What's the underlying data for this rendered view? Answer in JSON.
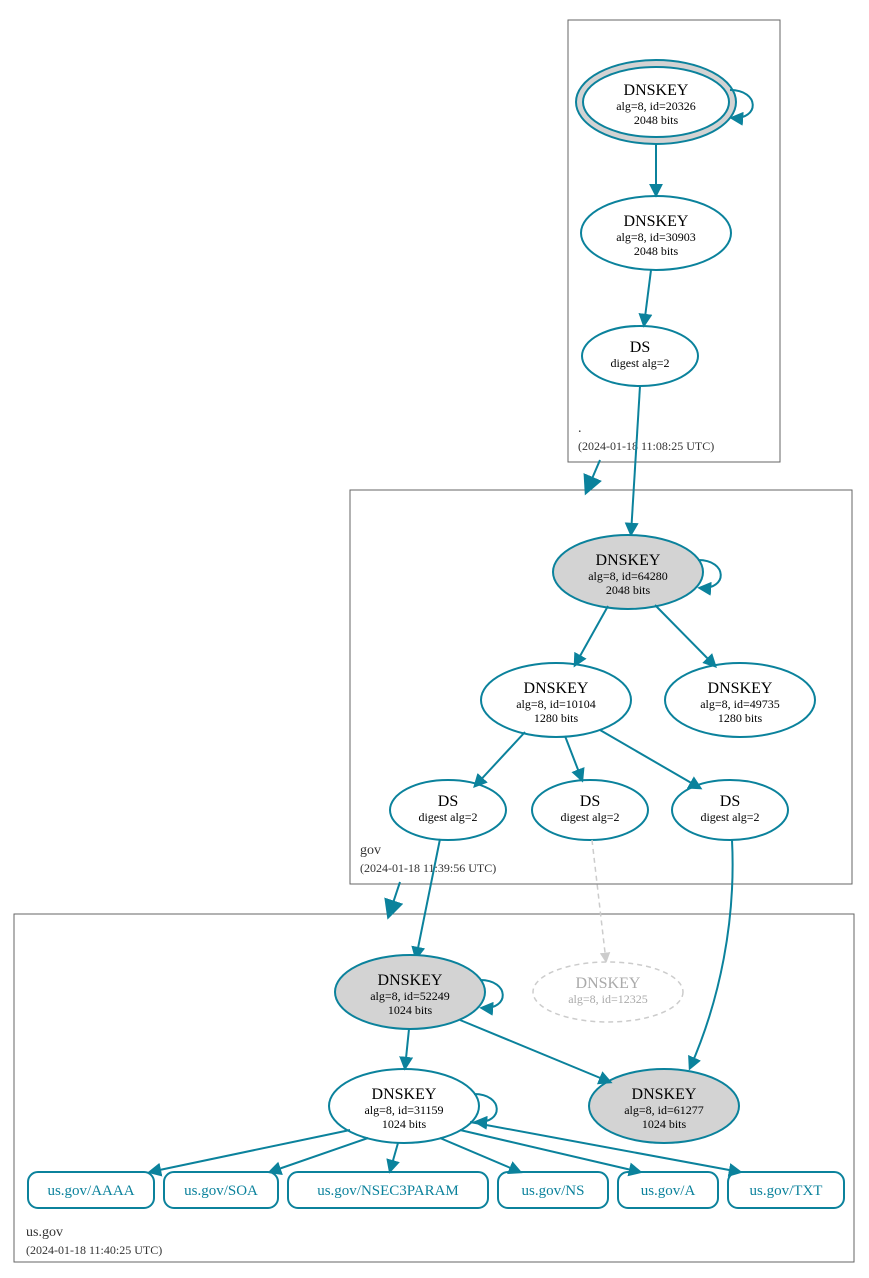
{
  "zones": {
    "root": {
      "label": ".",
      "date": "(2024-01-18 11:08:25 UTC)"
    },
    "gov": {
      "label": "gov",
      "date": "(2024-01-18 11:39:56 UTC)"
    },
    "usgov": {
      "label": "us.gov",
      "date": "(2024-01-18 11:40:25 UTC)"
    }
  },
  "nodes": {
    "root_ksk": {
      "title": "DNSKEY",
      "line1": "alg=8, id=20326",
      "line2": "2048 bits"
    },
    "root_zsk": {
      "title": "DNSKEY",
      "line1": "alg=8, id=30903",
      "line2": "2048 bits"
    },
    "root_ds": {
      "title": "DS",
      "line1": "digest alg=2"
    },
    "gov_ksk": {
      "title": "DNSKEY",
      "line1": "alg=8, id=64280",
      "line2": "2048 bits"
    },
    "gov_zsk1": {
      "title": "DNSKEY",
      "line1": "alg=8, id=10104",
      "line2": "1280 bits"
    },
    "gov_zsk2": {
      "title": "DNSKEY",
      "line1": "alg=8, id=49735",
      "line2": "1280 bits"
    },
    "gov_ds1": {
      "title": "DS",
      "line1": "digest alg=2"
    },
    "gov_ds2": {
      "title": "DS",
      "line1": "digest alg=2"
    },
    "gov_ds3": {
      "title": "DS",
      "line1": "digest alg=2"
    },
    "us_ksk": {
      "title": "DNSKEY",
      "line1": "alg=8, id=52249",
      "line2": "1024 bits"
    },
    "us_missing": {
      "title": "DNSKEY",
      "line1": "alg=8, id=12325"
    },
    "us_ksk2": {
      "title": "DNSKEY",
      "line1": "alg=8, id=61277",
      "line2": "1024 bits"
    },
    "us_zsk": {
      "title": "DNSKEY",
      "line1": "alg=8, id=31159",
      "line2": "1024 bits"
    }
  },
  "rrsets": {
    "aaaa": "us.gov/AAAA",
    "soa": "us.gov/SOA",
    "nsec3": "us.gov/NSEC3PARAM",
    "ns": "us.gov/NS",
    "a": "us.gov/A",
    "txt": "us.gov/TXT"
  }
}
